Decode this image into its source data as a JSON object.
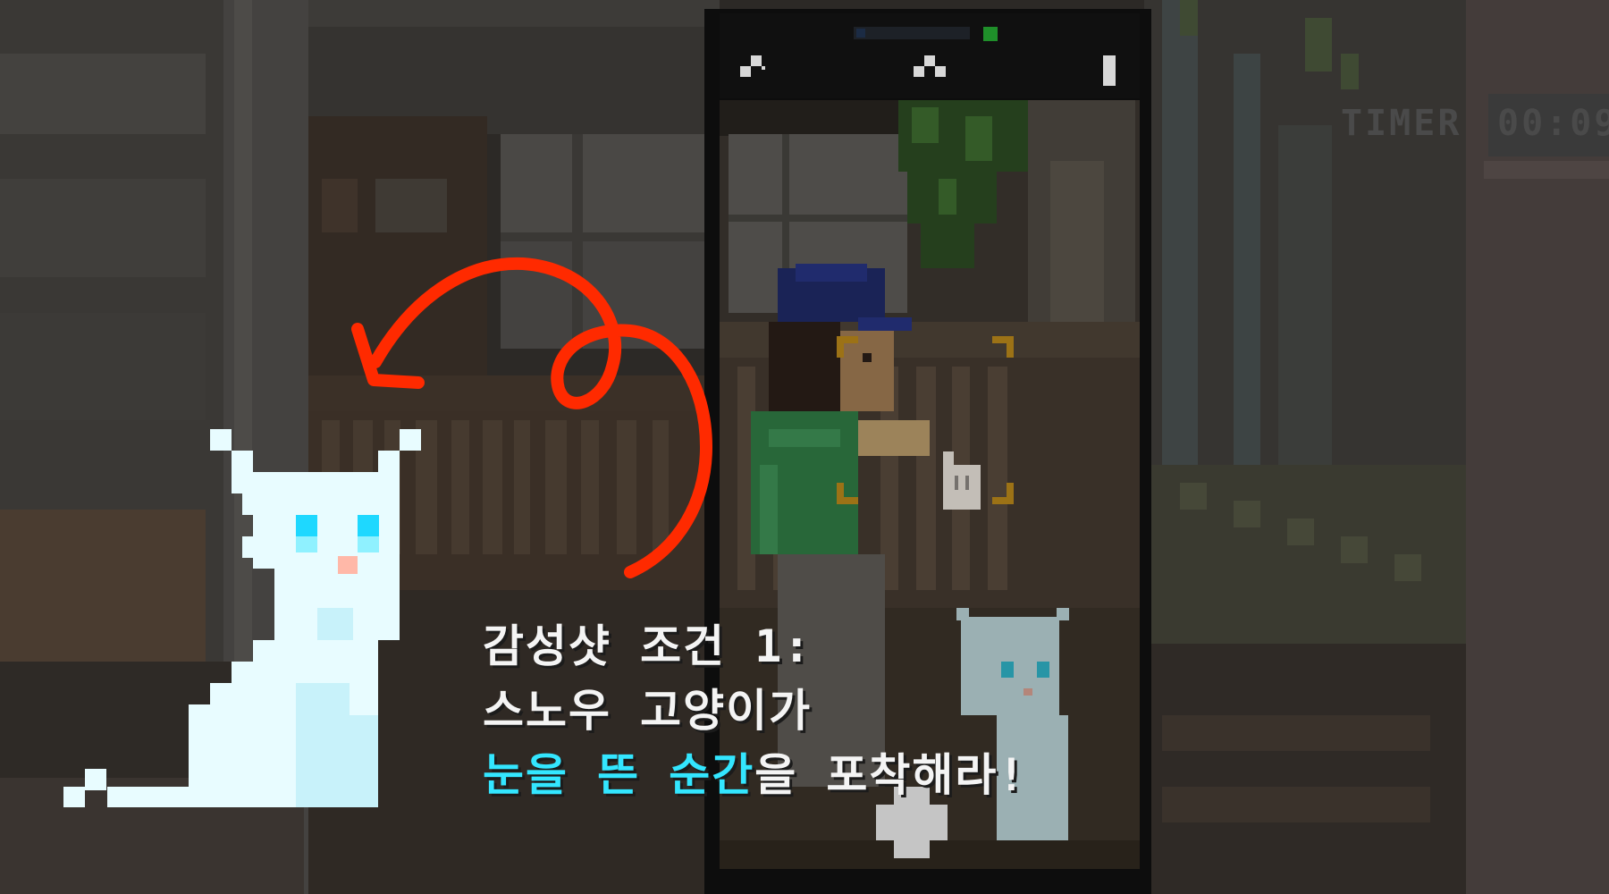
{
  "hud": {
    "timer_label": "TIMER",
    "timer_value": "00:09"
  },
  "caption": {
    "line1": "감성샷 조건 1:",
    "line2": "스노우 고양이가",
    "line3_highlight_a": "눈을 뜬",
    "line3_space": " ",
    "line3_highlight_b": "순간",
    "line3_rest": "을 포착해라!"
  },
  "colors": {
    "highlight": "#33e6ff",
    "caption_text": "#f4f4f4",
    "arrow": "#ff2a00",
    "focus_bracket": "#c8901a",
    "cat_fur": "#e8fcff",
    "cat_eye": "#1ed8ff",
    "cat_nose": "#ffb8a8"
  },
  "icons": [
    "snow-cat-sprite",
    "curved-arrow",
    "hand-cursor-icon",
    "camera-focus-bracket",
    "flash-icon",
    "phone-shutter-button-icon"
  ]
}
